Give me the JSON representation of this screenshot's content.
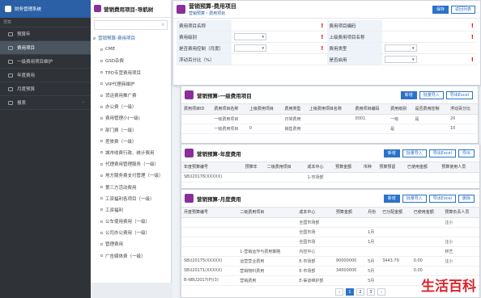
{
  "sidebar": {
    "header": "财务管理系统",
    "section": "预算",
    "items": [
      {
        "label": "预算年"
      },
      {
        "label": "费用项目"
      },
      {
        "label": "一级费用项目维护"
      },
      {
        "label": "年度费用"
      },
      {
        "label": "月度预算"
      },
      {
        "label": "报表"
      }
    ]
  },
  "tree": {
    "title": "营销费用项目-导航树",
    "items": [
      {
        "label": "营销预算-费用项目",
        "kind": "root"
      },
      {
        "label": "CME"
      },
      {
        "label": "GSD杂费"
      },
      {
        "label": "TPO专营费用项目"
      },
      {
        "label": "VIP代理商维护"
      },
      {
        "label": "货运费用推广费"
      },
      {
        "label": "办公费（一级）"
      },
      {
        "label": "费用管理小(一级)"
      },
      {
        "label": "部门费（一级）"
      },
      {
        "label": "差旅费（一级）"
      },
      {
        "label": "城市收费行政、统计费用"
      },
      {
        "label": "代理费用管理服务（一级）"
      },
      {
        "label": "地方服务费支付管理（一级）"
      },
      {
        "label": "第三方活动费用"
      },
      {
        "label": "工资福利各项目（一级）"
      },
      {
        "label": "工资福利"
      },
      {
        "label": "公车使用费用（一级）"
      },
      {
        "label": "公司办公费用（一级）"
      },
      {
        "label": "管理费用"
      },
      {
        "label": "广告媒体费（一级）"
      }
    ]
  },
  "form_card": {
    "title": "营销预算-费用项目",
    "crumb": "营销预算 › 费用项目",
    "save": "保存",
    "back": "返回列表",
    "rows": [
      [
        {
          "label": "费用项目名称",
          "req": true
        },
        {
          "label": "费用项目编码",
          "req": true
        }
      ],
      [
        {
          "label": "费用级别",
          "sel": true,
          "req": true
        },
        {
          "label": "上级费用项目名称",
          "req": true
        }
      ],
      [
        {
          "label": "是否费用控制（月度）",
          "sel": true,
          "req": true
        },
        {
          "label": "费用类型",
          "sel": true
        }
      ],
      [
        {
          "label": "浮动百分比（%）"
        },
        {
          "label": "是否启用",
          "sel": true,
          "req": true
        }
      ]
    ]
  },
  "card2": {
    "title": "营销预算-一级费用项目",
    "buttons": [
      "新增",
      "批量导入",
      "导出Excel"
    ],
    "columns": [
      "费用项目ID",
      "费用项目名称",
      "上级费用项目",
      "费用类型",
      "上级费用项目名称",
      "费用项目编码",
      "费用级别",
      "是否费用控制",
      "浮动百分比"
    ],
    "rows": [
      [
        "",
        "一级费用项目",
        "",
        "日常费用",
        "",
        "0001",
        "一级",
        "是",
        "20"
      ],
      [
        "",
        "一级费用项目",
        "0",
        "销售费用",
        "",
        "",
        "是",
        "",
        "10"
      ]
    ]
  },
  "card3": {
    "title": "营销预算-年度费用",
    "buttons": [
      "新增",
      "批量导入",
      "导出Excel",
      "导出"
    ],
    "columns": [
      "年度预算编号",
      "预算年",
      "二级费用项目",
      "成本中心",
      "预算金额",
      "币种",
      "预算预留",
      "已使用金额",
      "预算使用人员"
    ],
    "rows": [
      [
        "SBU20176(XXXXX)",
        "",
        "",
        "1-市场部",
        "",
        "",
        "",
        "",
        ""
      ]
    ]
  },
  "card4": {
    "title": "营销预算-月度费用",
    "buttons": [
      "新增",
      "批量导入",
      "导出Excel",
      "删除"
    ],
    "columns": [
      "月度预算编号",
      "二级费用项目",
      "成本中心",
      "预算金额",
      "月份",
      "已分配金额",
      "已使用金额",
      "预算负责人员"
    ],
    "rows": [
      [
        "",
        "",
        "全国市场部",
        "",
        "",
        "",
        "",
        "汪小"
      ],
      [
        "",
        "",
        "全国市场",
        "",
        "1月",
        "",
        "",
        ""
      ],
      [
        "",
        "",
        "全国市场",
        "",
        "1月",
        "",
        "",
        "汪小"
      ],
      [
        "",
        "1-营销运作与费用策略",
        "内控中心",
        "",
        "",
        "",
        "",
        "林艺"
      ],
      [
        "SBU20175(XXXXX)",
        "运营营业费用",
        "E-市场部",
        "90000000",
        "5月",
        "3443.79",
        "0.00",
        "汪小"
      ],
      [
        "SBU20171(XXXXX)",
        "营销物料费用",
        "E-市场部",
        "34000000",
        "5月",
        "",
        "0.00",
        ""
      ],
      [
        "B-NBU2017(P)(3)",
        "营销费用",
        "E-渠道维护部",
        "",
        "5月",
        "",
        "",
        ""
      ]
    ],
    "pages": [
      "1",
      "2",
      "3"
    ]
  },
  "watermark": "生活百科",
  "colors": {
    "sidebar": "#2f3338",
    "accent": "#2b72c9",
    "brand": "#8b2e9b",
    "required": "#d00000"
  }
}
